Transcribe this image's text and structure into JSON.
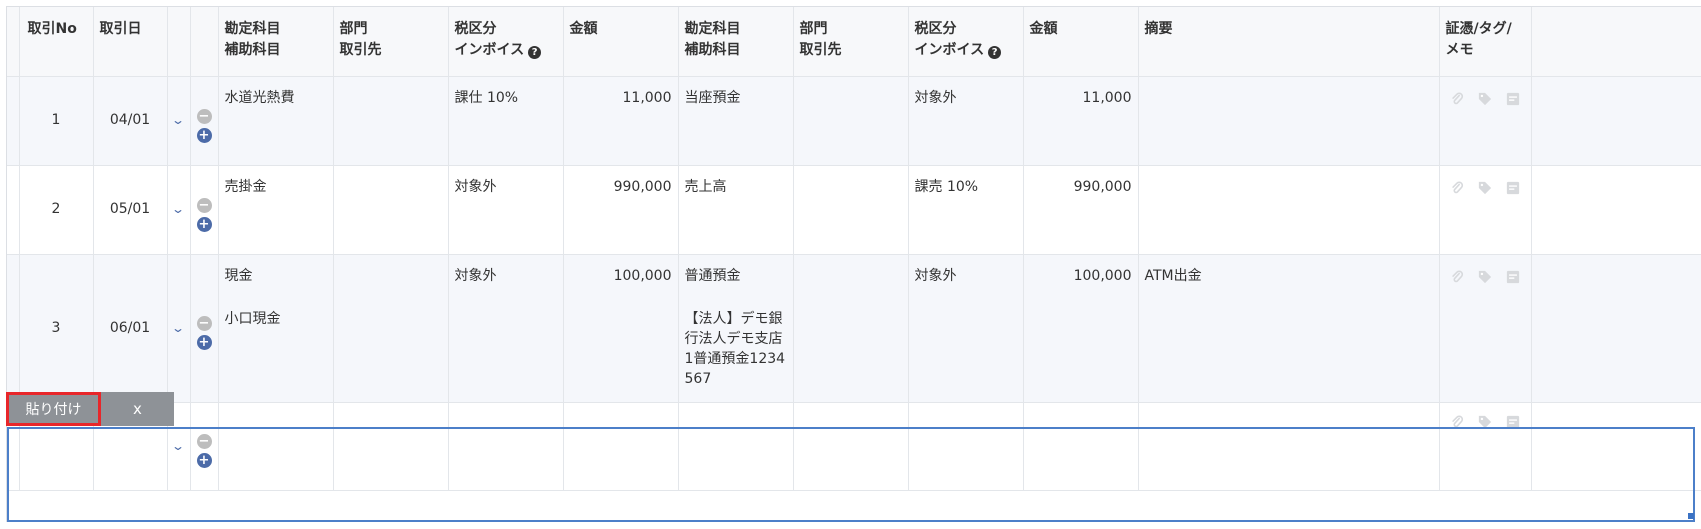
{
  "header": {
    "no": "取引No",
    "date": "取引日",
    "debit_account": "勘定科目",
    "debit_sub": "補助科目",
    "debit_dept": "部門",
    "debit_partner": "取引先",
    "debit_tax": "税区分",
    "debit_invoice": "インボイス",
    "debit_amount": "金額",
    "credit_account": "勘定科目",
    "credit_sub": "補助科目",
    "credit_dept": "部門",
    "credit_partner": "取引先",
    "credit_tax": "税区分",
    "credit_invoice": "インボイス",
    "credit_amount": "金額",
    "memo": "摘要",
    "evidence_line1": "証憑/タグ/",
    "evidence_line2": "メモ"
  },
  "rows": [
    {
      "no": "1",
      "date": "04/01",
      "debit_account": "水道光熱費",
      "debit_sub": "",
      "debit_tax": "課仕 10%",
      "debit_amount": "11,000",
      "credit_account": "当座預金",
      "credit_sub": "",
      "credit_tax": "対象外",
      "credit_amount": "11,000",
      "memo": ""
    },
    {
      "no": "2",
      "date": "05/01",
      "debit_account": "売掛金",
      "debit_sub": "",
      "debit_tax": "対象外",
      "debit_amount": "990,000",
      "credit_account": "売上高",
      "credit_sub": "",
      "credit_tax": "課売 10%",
      "credit_amount": "990,000",
      "memo": ""
    },
    {
      "no": "3",
      "date": "06/01",
      "debit_account": "現金",
      "debit_sub": "小口現金",
      "debit_tax": "対象外",
      "debit_amount": "100,000",
      "credit_account": "普通預金",
      "credit_sub": "【法人】デモ銀行法人デモ支店1普通預金1234567",
      "credit_tax": "対象外",
      "credit_amount": "100,000",
      "memo": "ATM出金"
    }
  ],
  "paste_bar": {
    "paste_label": "貼り付け",
    "close_label": "x"
  },
  "icons": {
    "expand": "chevron-down-icon",
    "remove_line": "minus-circle-icon",
    "add_line": "plus-circle-icon",
    "attach": "paperclip-icon",
    "tag": "tag-icon",
    "note": "note-icon",
    "help": "question-circle-icon"
  },
  "colors": {
    "accent": "#4c6ba8",
    "highlight": "#e8262a",
    "selection": "#4c7fc9",
    "paste_bar": "#8e9297"
  }
}
